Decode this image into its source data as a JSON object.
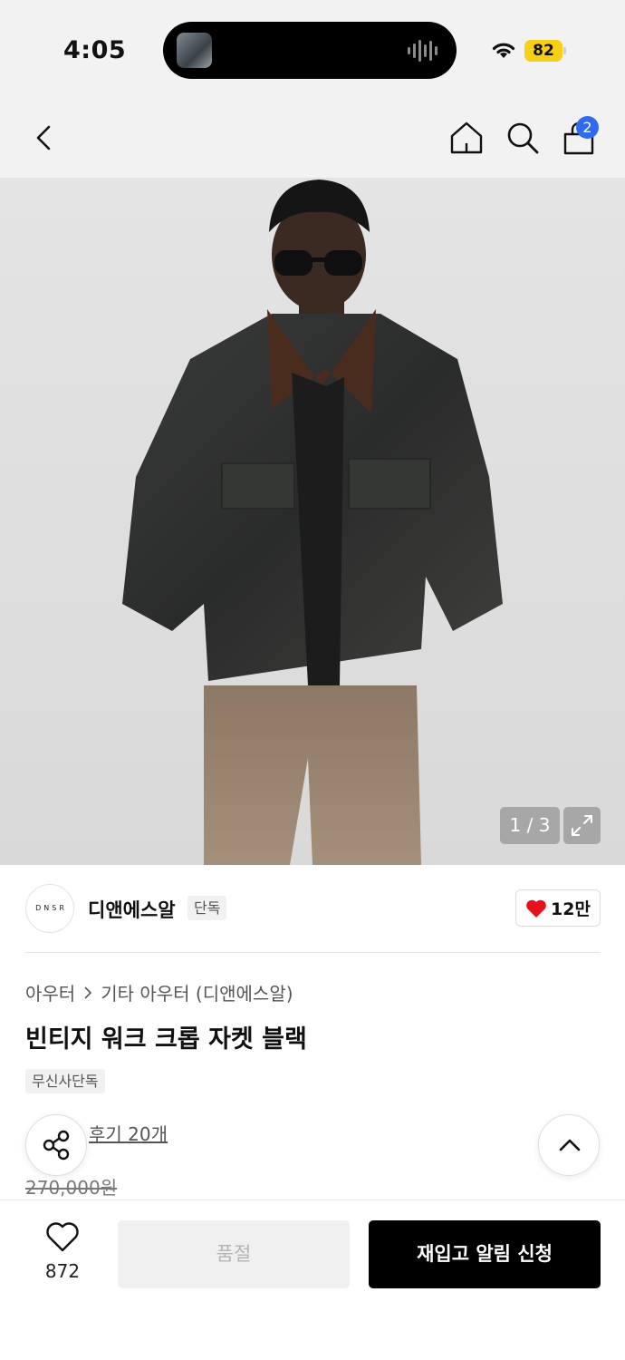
{
  "status_bar": {
    "time": "4:05",
    "battery": "82"
  },
  "nav": {
    "cart_count": "2"
  },
  "gallery": {
    "counter": "1 / 3"
  },
  "brand": {
    "logo_text": "DNSR",
    "name": "디앤에스알",
    "tag": "단독",
    "likes": "12만"
  },
  "product": {
    "breadcrumb": [
      "아우터",
      "기타 아우터 (디앤에스알)"
    ],
    "title": "빈티지 워크 크롭 자켓 블랙",
    "exclusive_tag": "무신사단독",
    "reviews": "후기 20개",
    "original_price": "270,000원"
  },
  "bottom_bar": {
    "wish_count": "872",
    "soldout_label": "품절",
    "restock_label": "재입고 알림 신청"
  },
  "colors": {
    "accent": "#2f6bf0",
    "heart": "#e4101b",
    "battery": "#f7cf17"
  }
}
